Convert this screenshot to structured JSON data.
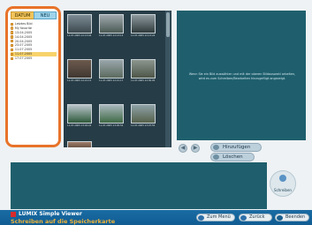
{
  "left_panel": {
    "tabs": [
      {
        "label": "DATUM"
      },
      {
        "label": "NEU"
      }
    ],
    "dates": [
      {
        "label": "Letztes Bild"
      },
      {
        "label": "My favorite"
      },
      {
        "label": "13.04.2005"
      },
      {
        "label": "14.04.2005"
      },
      {
        "label": "20.04.2005"
      },
      {
        "label": "23.07.2005"
      },
      {
        "label": "11.07.2005"
      },
      {
        "label": "11.07.2005",
        "selected": true
      },
      {
        "label": "17.07.2005"
      }
    ]
  },
  "thumbnails": {
    "captions": [
      "11.07.2005 12:13:04",
      "11.07.2005 12:13:13",
      "11.07.2005 12:13:24",
      "11.07.2005 12:21:15",
      "11.07.2005 12:21:17",
      "11.07.2005 12:30:05",
      "11.07.2005 13:02:22",
      "11.07.2005 13:05:52",
      "11.07.2005 13:07:55"
    ]
  },
  "preview": {
    "message": "Wenn Sie ein Bild auswählen und mit der oberen Bildauswahl arbeiten, wird es zum Schreiben/Bearbeiten hinzugefügt angezeigt."
  },
  "controls": {
    "prev_symbol": "◀",
    "next_symbol": "▶",
    "add_label": "Hinzufügen",
    "delete_label": "Löschen",
    "write_label": "Schreiben"
  },
  "footer": {
    "brand": "LUMIX Simple Viewer",
    "subtitle": "Schreiben auf die Speicherkarte",
    "buttons": [
      {
        "label": "Zum Menü"
      },
      {
        "label": "Zurück"
      },
      {
        "label": "Beenden"
      }
    ]
  },
  "colors": {
    "highlight_border": "#e8732a",
    "dark_panel": "#263c46",
    "preview_panel": "#1f5f6d",
    "footer_blue": "#1a6ca4"
  }
}
